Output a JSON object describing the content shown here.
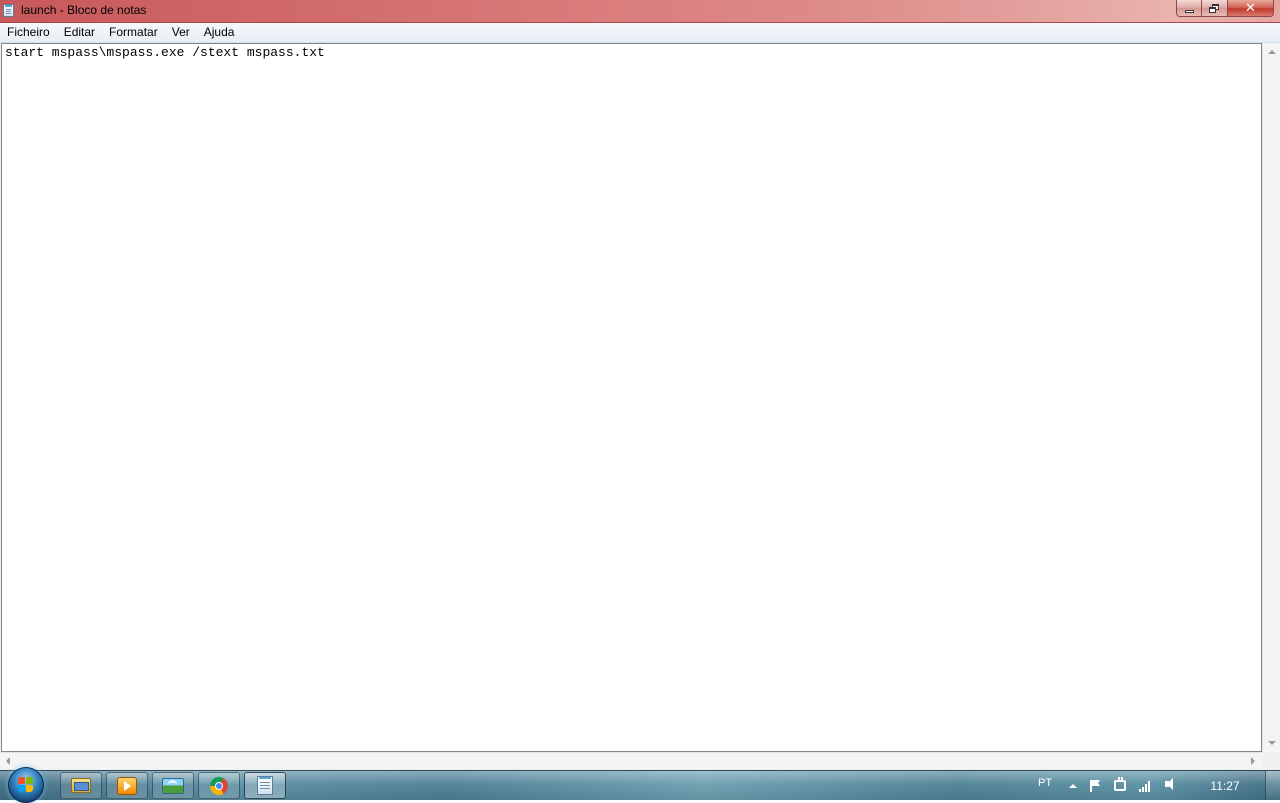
{
  "window": {
    "title": "launch - Bloco de notas",
    "icon": "notepad-icon",
    "controls": {
      "minimize": "minimize-icon",
      "maximize": "restore-icon",
      "close": "✕"
    }
  },
  "menu": {
    "items": [
      {
        "label": "Ficheiro"
      },
      {
        "label": "Editar"
      },
      {
        "label": "Formatar"
      },
      {
        "label": "Ver"
      },
      {
        "label": "Ajuda"
      }
    ]
  },
  "editor": {
    "content": "start mspass\\mspass.exe /stext mspass.txt"
  },
  "taskbar": {
    "pinned": [
      {
        "name": "windows-explorer",
        "icon": "folder-icon"
      },
      {
        "name": "media-player",
        "icon": "media-player-icon"
      },
      {
        "name": "photo-gallery",
        "icon": "photo-gallery-icon"
      },
      {
        "name": "chrome",
        "icon": "chrome-icon"
      },
      {
        "name": "notepad",
        "icon": "notepad-icon",
        "active": true
      }
    ],
    "tray": {
      "language": "PT",
      "clock": "11:27"
    }
  },
  "colors": {
    "titlebar_accent": "#d16b6c",
    "close_button": "#c0392b",
    "taskbar": "#4c7f95"
  }
}
